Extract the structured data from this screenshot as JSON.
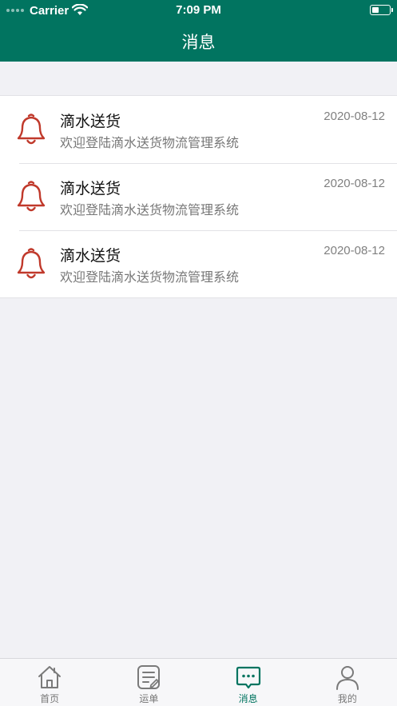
{
  "status_bar": {
    "carrier": "Carrier",
    "time": "7:09 PM"
  },
  "nav": {
    "title": "消息"
  },
  "messages": [
    {
      "title": "滴水送货",
      "subtitle": "欢迎登陆滴水送货物流管理系统",
      "date": "2020-08-12",
      "icon": "bell-icon"
    },
    {
      "title": "滴水送货",
      "subtitle": "欢迎登陆滴水送货物流管理系统",
      "date": "2020-08-12",
      "icon": "bell-icon"
    },
    {
      "title": "滴水送货",
      "subtitle": "欢迎登陆滴水送货物流管理系统",
      "date": "2020-08-12",
      "icon": "bell-icon"
    }
  ],
  "tabs": [
    {
      "label": "首页",
      "icon": "home-icon",
      "active": false
    },
    {
      "label": "运单",
      "icon": "waybill-icon",
      "active": false
    },
    {
      "label": "消息",
      "icon": "message-icon",
      "active": true
    },
    {
      "label": "我的",
      "icon": "profile-icon",
      "active": false
    }
  ],
  "colors": {
    "brand": "#017460",
    "bell": "#c0392b",
    "background": "#f1f1f5"
  }
}
